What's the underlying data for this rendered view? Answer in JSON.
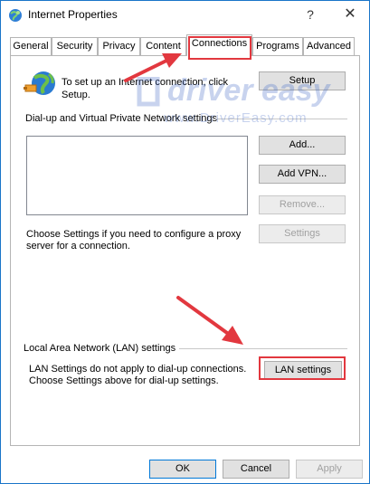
{
  "window": {
    "title": "Internet Properties",
    "help_glyph": "?",
    "close_glyph": "✕"
  },
  "tabs": [
    {
      "label": "General",
      "active": false
    },
    {
      "label": "Security",
      "active": false
    },
    {
      "label": "Privacy",
      "active": false
    },
    {
      "label": "Content",
      "active": false
    },
    {
      "label": "Connections",
      "active": true
    },
    {
      "label": "Programs",
      "active": false
    },
    {
      "label": "Advanced",
      "active": false
    }
  ],
  "setup_section": {
    "text_line1": "To set up an Internet connection, click",
    "text_line2": "Setup.",
    "setup_button": "Setup",
    "icon": "globe-connection-icon"
  },
  "dialup_section": {
    "heading": "Dial-up and Virtual Private Network settings",
    "add_button": "Add...",
    "add_vpn_button": "Add VPN...",
    "remove_button": "Remove...",
    "settings_button": "Settings",
    "proxy_text_line1": "Choose Settings if you need to configure a proxy",
    "proxy_text_line2": "server for a connection."
  },
  "lan_section": {
    "heading": "Local Area Network (LAN) settings",
    "text_line1": "LAN Settings do not apply to dial-up connections.",
    "text_line2": "Choose Settings above for dial-up settings.",
    "lan_button": "LAN settings"
  },
  "footer": {
    "ok": "OK",
    "cancel": "Cancel",
    "apply": "Apply"
  },
  "watermark": {
    "logo_text": "driver easy",
    "url_text": "www.DriverEasy.com"
  },
  "colors": {
    "annotation_red": "#e2383f",
    "watermark_blue": "#3c66c6",
    "window_border": "#1a75c9"
  }
}
